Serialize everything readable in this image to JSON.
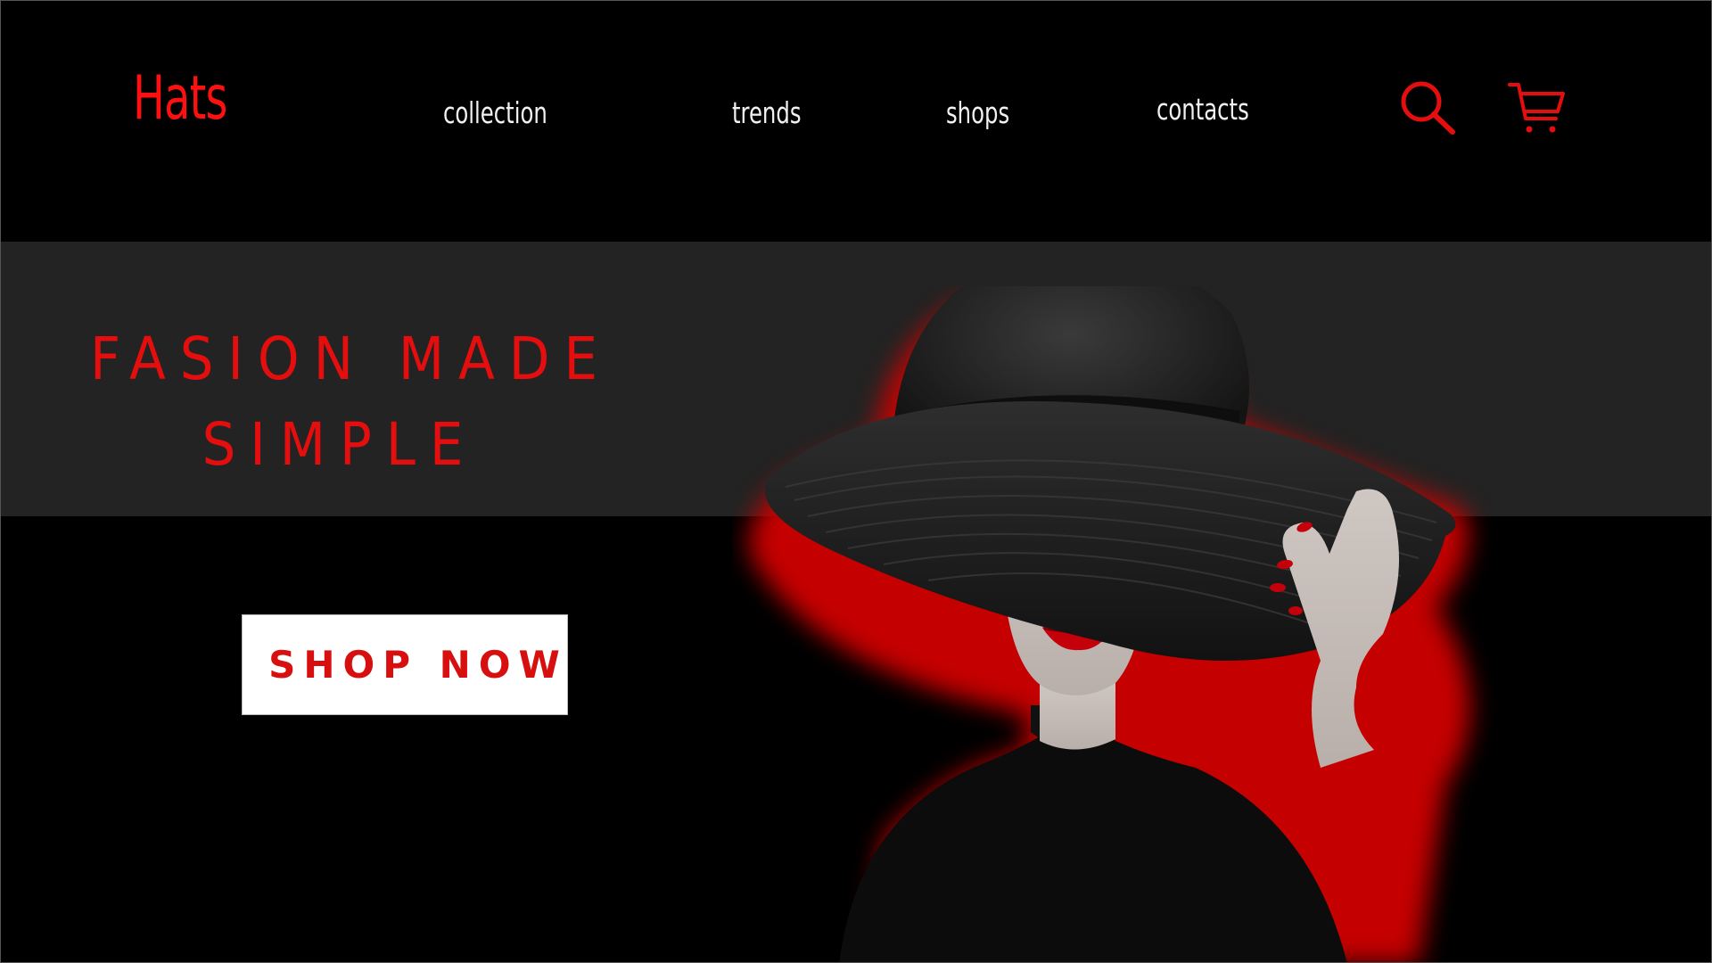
{
  "header": {
    "logo": "Hats",
    "nav": [
      {
        "label": "collection"
      },
      {
        "label": "trends"
      },
      {
        "label": "shops"
      },
      {
        "label": "contacts"
      }
    ],
    "icons": {
      "search": "search-icon",
      "cart": "cart-icon"
    }
  },
  "hero": {
    "headline_line1": "FASION MADE",
    "headline_line2": "SIMPLE",
    "cta_label": "SHOP NOW",
    "image": "woman-wearing-wide-brim-black-hat"
  },
  "colors": {
    "background": "#000000",
    "band": "#232323",
    "accent": "#e40e0e",
    "nav_text": "#f2f2f2",
    "button_bg": "#ffffff"
  }
}
